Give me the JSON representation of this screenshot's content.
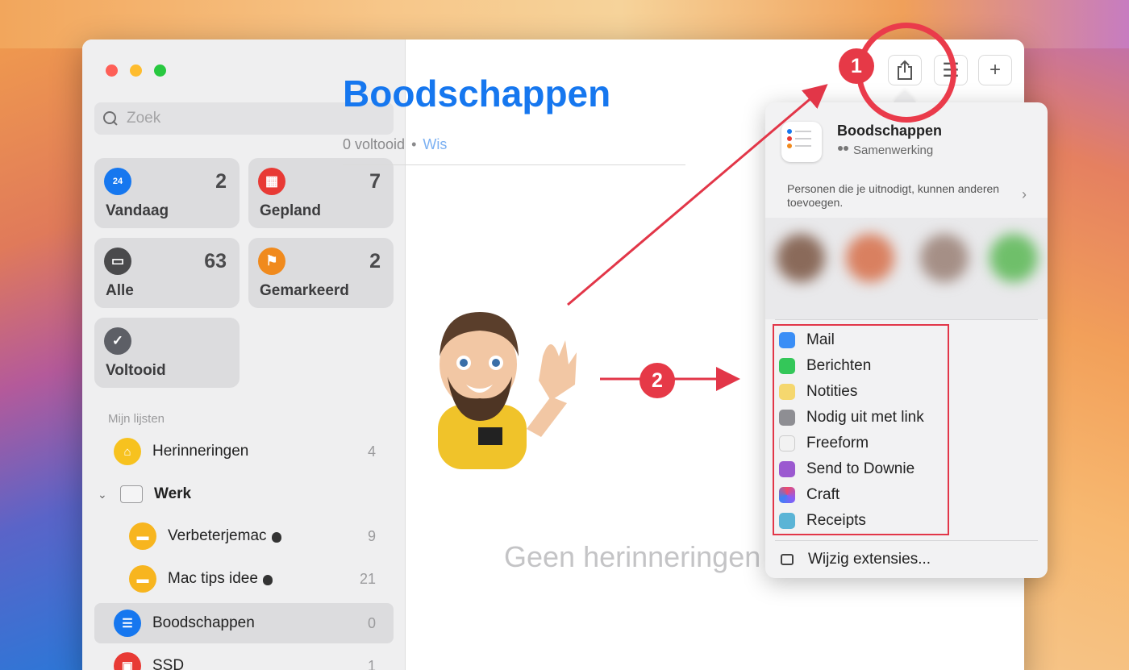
{
  "sidebar": {
    "search_placeholder": "Zoek",
    "tiles": [
      {
        "label": "Vandaag",
        "count": "2",
        "color": "#1677ef",
        "icon": "calendar-today-icon",
        "glyph": "24"
      },
      {
        "label": "Gepland",
        "count": "7",
        "color": "#e83a35",
        "icon": "calendar-grid-icon",
        "glyph": "▦"
      },
      {
        "label": "Alle",
        "count": "63",
        "color": "#4a4a4c",
        "icon": "tray-icon",
        "glyph": "▭"
      },
      {
        "label": "Gemarkeerd",
        "count": "2",
        "color": "#f08a1d",
        "icon": "flag-icon",
        "glyph": "⚑"
      },
      {
        "label": "Voltooid",
        "count": "",
        "color": "#5d5f66",
        "icon": "checkmark-icon",
        "glyph": "✓"
      }
    ],
    "section_title": "Mijn lijsten",
    "lists": [
      {
        "label": "Herinneringen",
        "count": "4",
        "color": "#f7c21f",
        "icon": "chair-icon"
      },
      {
        "label": "Werk",
        "count": "",
        "icon": "folder-icon"
      },
      {
        "label": "Verbeterjemac",
        "count": "9",
        "color": "#f7b51f",
        "icon": "briefcase-icon"
      },
      {
        "label": "Mac tips idee",
        "count": "21",
        "color": "#f7b51f",
        "icon": "briefcase-icon"
      },
      {
        "label": "Boodschappen",
        "count": "0",
        "color": "#1677ef",
        "icon": "list-bullet-icon"
      },
      {
        "label": "SSD",
        "count": "1",
        "color": "#e83a35",
        "icon": "ssd-icon"
      }
    ]
  },
  "main": {
    "title": "Boodschappen",
    "completed": "0 voltooid",
    "separator": "•",
    "clear": "Wis",
    "empty": "Geen herinneringen"
  },
  "annotations": {
    "one": "1",
    "two": "2"
  },
  "popover": {
    "title": "Boodschappen",
    "subtitle": "Samenwerking",
    "invite_text": "Personen die je uitnodigt, kunnen anderen toevoegen.",
    "share_items": [
      {
        "label": "Mail",
        "icon": "mail-icon",
        "color": "#3a8ef6"
      },
      {
        "label": "Berichten",
        "icon": "messages-icon",
        "color": "#34c759"
      },
      {
        "label": "Notities",
        "icon": "notes-icon",
        "color": "#f5d76e"
      },
      {
        "label": "Nodig uit met link",
        "icon": "link-icon",
        "color": "#8e8e93"
      },
      {
        "label": "Freeform",
        "icon": "freeform-icon",
        "color": "#f2f2f2"
      },
      {
        "label": "Send to Downie",
        "icon": "downie-icon",
        "color": "#9b59d0"
      },
      {
        "label": "Craft",
        "icon": "craft-icon",
        "color": "#ffffff"
      },
      {
        "label": "Receipts",
        "icon": "receipts-icon",
        "color": "#5ab4d6"
      }
    ],
    "edit_extensions": "Wijzig extensies..."
  }
}
